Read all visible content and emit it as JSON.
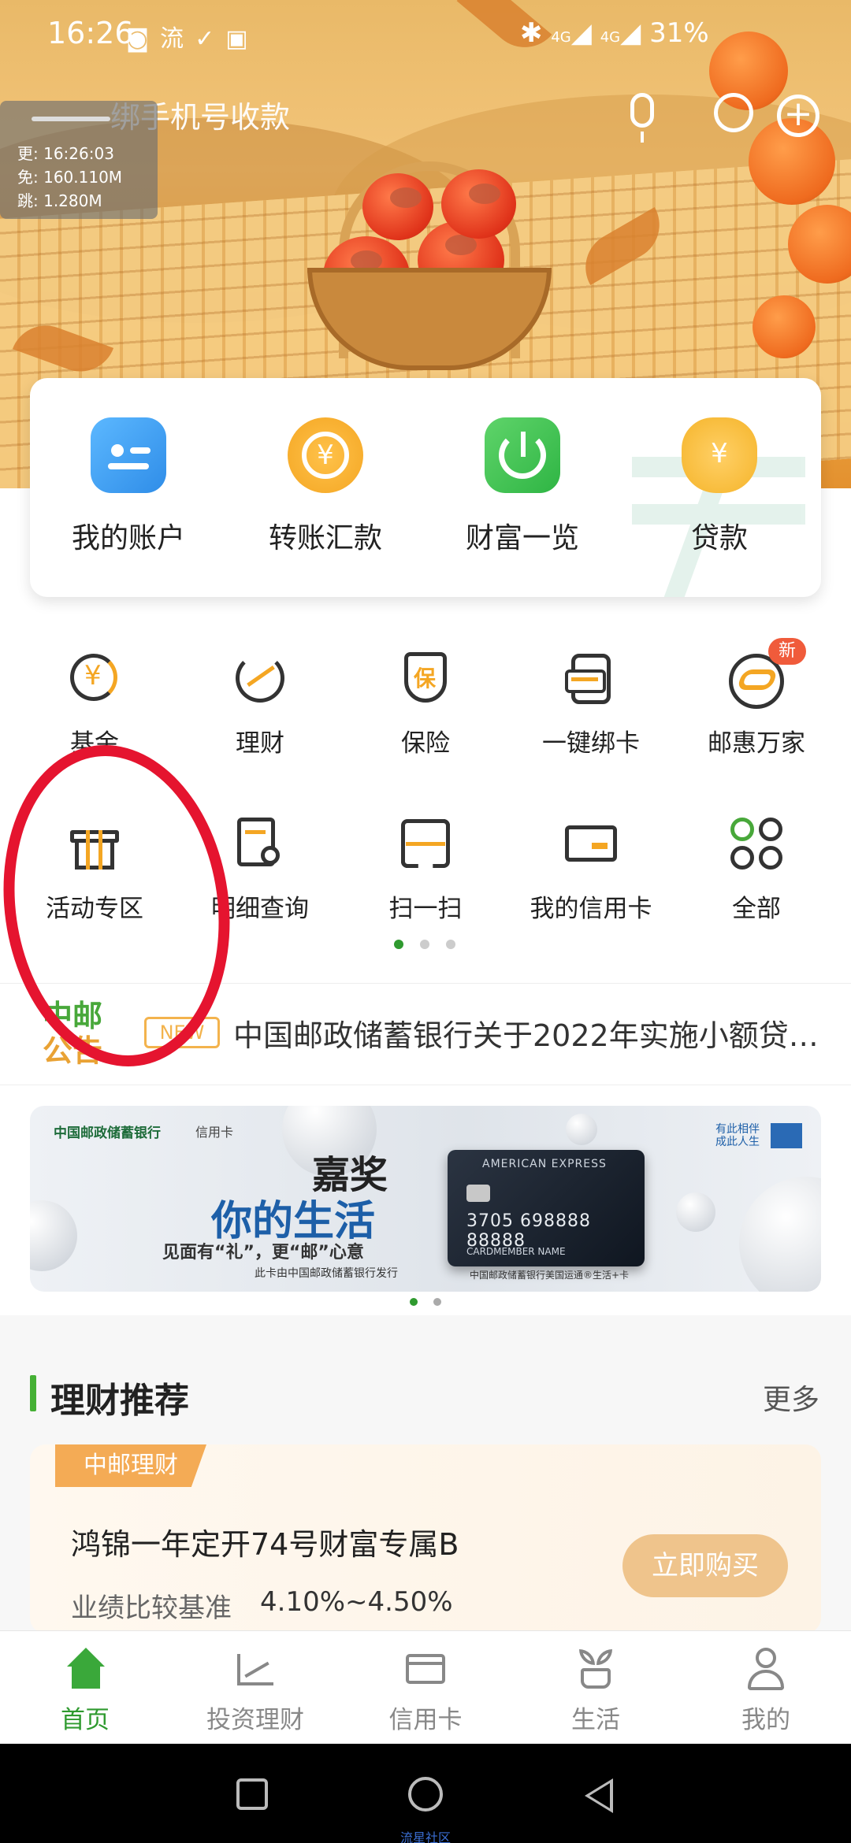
{
  "status_bar": {
    "time": "16:26",
    "app_badge": "流",
    "signal_badge_1": "4G",
    "signal_badge_2": "4G",
    "battery": "31%"
  },
  "header": {
    "search_text": "绑手机号收款"
  },
  "debug_overlay": {
    "line1": "更: 16:26:03",
    "line2": "免: 160.110M",
    "line3": "跳: 1.280M"
  },
  "quick_actions": [
    {
      "label": "我的账户",
      "icon": "account-doc-icon"
    },
    {
      "label": "转账汇款",
      "icon": "transfer-coin-icon"
    },
    {
      "label": "财富一览",
      "icon": "wealth-pie-icon"
    },
    {
      "label": "贷款",
      "icon": "loan-bag-icon"
    }
  ],
  "grid_row1": [
    {
      "label": "基金",
      "icon": "fund-icon"
    },
    {
      "label": "理财",
      "icon": "finance-trend-icon"
    },
    {
      "label": "保险",
      "icon": "insurance-shield-icon"
    },
    {
      "label": "一键绑卡",
      "icon": "bind-card-icon"
    },
    {
      "label": "邮惠万家",
      "icon": "youhui-icon",
      "badge": "新"
    }
  ],
  "grid_row2": [
    {
      "label": "活动专区",
      "icon": "gift-icon"
    },
    {
      "label": "明细查询",
      "icon": "detail-search-icon"
    },
    {
      "label": "扫一扫",
      "icon": "scan-icon"
    },
    {
      "label": "我的信用卡",
      "icon": "credit-card-icon"
    },
    {
      "label": "全部",
      "icon": "all-apps-icon"
    }
  ],
  "notice": {
    "logo_line1": "中邮",
    "logo_line2": "公告",
    "badge": "NEW",
    "text": "中国邮政储蓄银行关于2022年实施小额贷…"
  },
  "banner": {
    "bank_name": "中国邮政储蓄银行",
    "card_type": "信用卡",
    "headline1": "嘉奖",
    "headline2": "你的生活",
    "subline": "见面有“礼”，更“邮”心意",
    "issuer_line": "此卡由中国邮政储蓄银行发行",
    "card_brand": "AMERICAN EXPRESS",
    "card_number": "3705 698888 88888",
    "card_holder": "CARDMEMBER NAME",
    "card_caption": "中国邮政储蓄银行美国运通®生活+卡",
    "slogan": "有此相伴 成此人生"
  },
  "section": {
    "title": "理财推荐",
    "more": "更多"
  },
  "product": {
    "tag": "中邮理财",
    "name": "鸿锦一年定开74号财富专属B",
    "rate_label": "业绩比较基准",
    "rate": "4.10%~4.50%",
    "button": "立即购买"
  },
  "tabbar": [
    {
      "label": "首页",
      "icon": "home-icon",
      "active": true
    },
    {
      "label": "投资理财",
      "icon": "invest-icon",
      "active": false
    },
    {
      "label": "信用卡",
      "icon": "card-icon",
      "active": false
    },
    {
      "label": "生活",
      "icon": "life-sprout-icon",
      "active": false
    },
    {
      "label": "我的",
      "icon": "profile-icon",
      "active": false
    }
  ],
  "watermark": "流星社区",
  "colors": {
    "brand_green": "#2f9a2f",
    "annotation_red": "#e5142f",
    "accent_orange": "#f4ab55"
  }
}
